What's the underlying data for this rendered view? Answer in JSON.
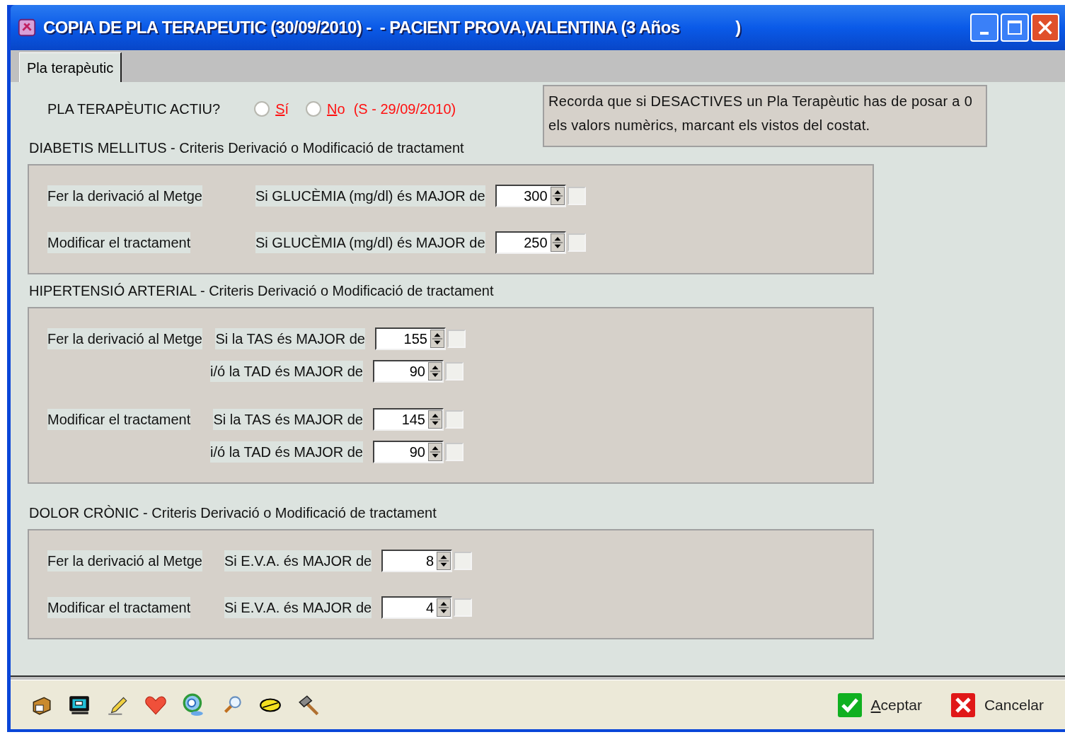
{
  "window": {
    "title": "COPIA DE PLA TERAPEUTIC (30/09/2010) -  - PACIENT PROVA,VALENTINA (3 Años             )"
  },
  "tabs": [
    {
      "label": "Pla terapèutic",
      "selected": true
    }
  ],
  "active_question": {
    "label": "PLA TERAPÈUTIC ACTIU?",
    "options": [
      {
        "label": "Sí",
        "selected": false
      },
      {
        "label": "No",
        "selected": false
      }
    ],
    "note": "(S - 29/09/2010)"
  },
  "reminder": "Recorda que si DESACTIVES un Pla Terapèutic has de posar a 0 els valors numèrics, marcant els vistos del costat.",
  "sections": [
    {
      "title": "DIABETIS MELLITUS  -  Criteris Derivació o Modificació de tractament",
      "rows": [
        {
          "action": "Fer la derivació al Metge",
          "condition": "Si GLUCÈMIA (mg/dl) és MAJOR de",
          "value": "300",
          "checked": false
        },
        {
          "action": "Modificar el tractament",
          "condition": "Si GLUCÈMIA (mg/dl) és MAJOR de",
          "value": "250",
          "checked": false
        }
      ]
    },
    {
      "title": "HIPERTENSIÓ ARTERIAL  -  Criteris Derivació o Modificació de tractament",
      "rows": [
        {
          "action": "Fer la derivació al Metge",
          "condition": "Si la TAS és MAJOR de",
          "value": "155",
          "checked": false
        },
        {
          "condition": "i/ó la TAD és MAJOR de",
          "value": "90",
          "checked": false
        },
        {
          "action": "Modificar el tractament",
          "condition": "Si la TAS és MAJOR de",
          "value": "145",
          "checked": false
        },
        {
          "condition": "i/ó la TAD és MAJOR de",
          "value": "90",
          "checked": false
        }
      ]
    },
    {
      "title": "DOLOR CRÒNIC  -  Criteris Derivació o Modificació de tractament",
      "rows": [
        {
          "action": "Fer la derivació al Metge",
          "condition": "Si E.V.A. és MAJOR de",
          "value": "8",
          "checked": false
        },
        {
          "action": "Modificar el tractament",
          "condition": "Si E.V.A. és MAJOR de",
          "value": "4",
          "checked": false
        }
      ]
    }
  ],
  "buttons": [
    {
      "label": "Aceptar",
      "kind": "accept"
    },
    {
      "label": "Cancelar",
      "kind": "cancel"
    }
  ]
}
